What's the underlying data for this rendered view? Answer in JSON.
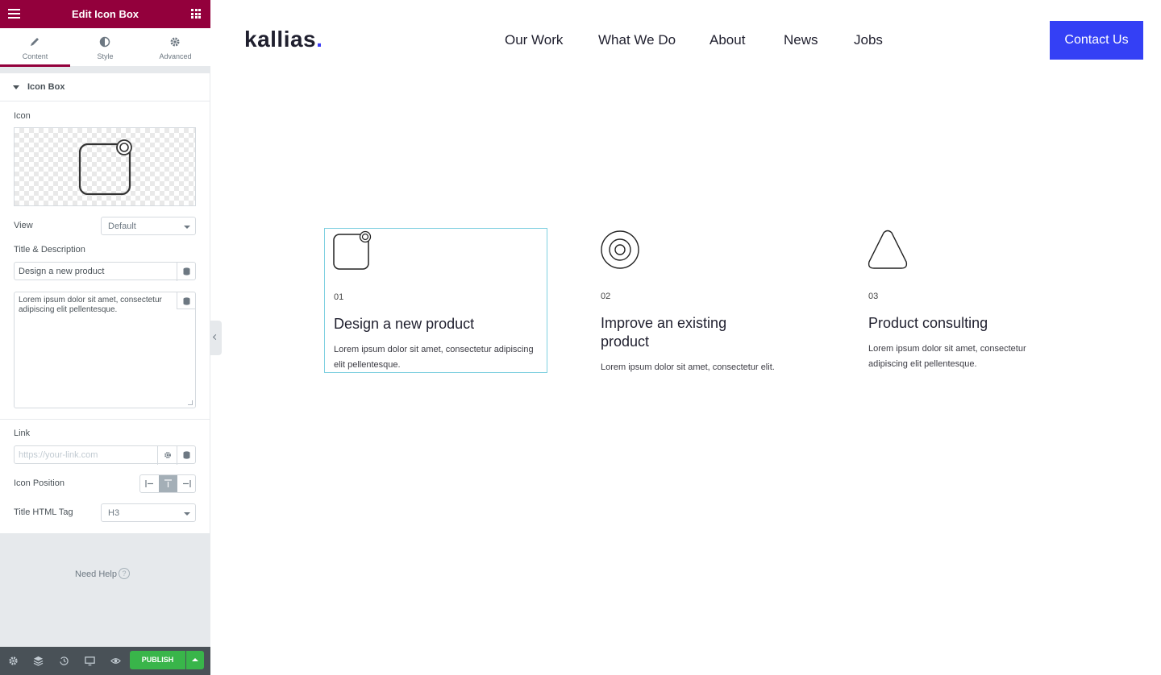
{
  "editor": {
    "header_title": "Edit Icon Box",
    "tabs": [
      {
        "label": "Content",
        "icon": "pencil-icon"
      },
      {
        "label": "Style",
        "icon": "contrast-icon"
      },
      {
        "label": "Advanced",
        "icon": "gear-icon"
      }
    ],
    "section_title": "Icon Box",
    "controls": {
      "icon_label": "Icon",
      "view_label": "View",
      "view_value": "Default",
      "title_desc_label": "Title & Description",
      "title_value": "Design a new product",
      "description_value": "Lorem ipsum dolor sit amet, consectetur adipiscing elit pellentesque.",
      "link_label": "Link",
      "link_placeholder": "https://your-link.com",
      "icon_position_label": "Icon Position",
      "title_tag_label": "Title HTML Tag",
      "title_tag_value": "H3"
    },
    "help_text": "Need Help",
    "publish_label": "PUBLISH"
  },
  "site": {
    "logo_text": "kallias",
    "logo_dot": ".",
    "nav": [
      "Our Work",
      "What We Do",
      "About",
      "News",
      "Jobs"
    ],
    "contact_label": "Contact Us",
    "cards": [
      {
        "number": "01",
        "title": "Design a new product",
        "description": "Lorem ipsum dolor sit amet, consectetur adipiscing elit pellentesque."
      },
      {
        "number": "02",
        "title": "Improve an existing product",
        "description": "Lorem ipsum dolor sit amet, consectetur elit."
      },
      {
        "number": "03",
        "title": "Product consulting",
        "description": "Lorem ipsum dolor sit amet, consectetur adipiscing elit pellentesque."
      }
    ]
  },
  "colors": {
    "editor_header": "#93003c",
    "publish_green": "#39b54a",
    "contact_blue": "#3440f5",
    "logo_dot": "#3b3bf5"
  }
}
